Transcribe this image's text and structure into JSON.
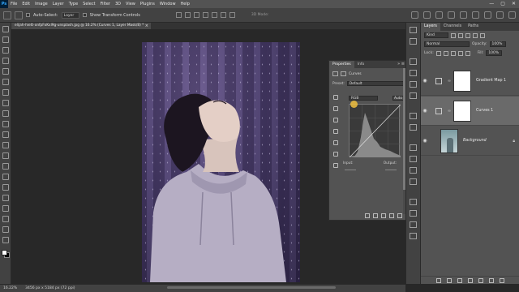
{
  "menubar": {
    "logo": "Ps",
    "items": [
      "File",
      "Edit",
      "Image",
      "Layer",
      "Type",
      "Select",
      "Filter",
      "3D",
      "View",
      "Plugins",
      "Window",
      "Help"
    ],
    "window_controls": [
      "—",
      "▢",
      "✕"
    ]
  },
  "options": {
    "auto_select_label": "Auto-Select:",
    "auto_select_value": "Layer",
    "transform_label": "Show Transform Controls",
    "mode_3d": "3D Mode:"
  },
  "document": {
    "tab_title": "elijah-hiett-onfpFoKxl9g-unsplash.jpg @ 16.2% (Curves 1, Layer Mask/8) *",
    "close": "×"
  },
  "properties": {
    "tabs": [
      "Properties",
      "Info"
    ],
    "menu": "»  ≡",
    "adjustment_name": "Curves",
    "preset_label": "Preset:",
    "preset_value": "Default",
    "channel_value": "RGB",
    "auto_label": "Auto",
    "input_label": "Input:",
    "output_label": "Output:"
  },
  "layers": {
    "tabs": [
      "Layers",
      "Channels",
      "Paths"
    ],
    "kind_label": "Kind",
    "blend_mode": "Normal",
    "opacity_label": "Opacity:",
    "opacity_value": "100%",
    "lock_label": "Lock:",
    "fill_label": "Fill:",
    "fill_value": "100%",
    "items": [
      {
        "name": "Gradient Map 1",
        "selected": false
      },
      {
        "name": "Curves 1",
        "selected": true
      },
      {
        "name": "Background",
        "selected": false
      }
    ]
  },
  "statusbar": {
    "zoom": "16.22%",
    "doc_size": "3456 px x 5184 px (72 ppi)"
  },
  "colors": {
    "menubar_bg": "#535353",
    "panel_bg": "#535353",
    "app_bg": "#282828",
    "photo_tint": "#4b3f6d"
  }
}
